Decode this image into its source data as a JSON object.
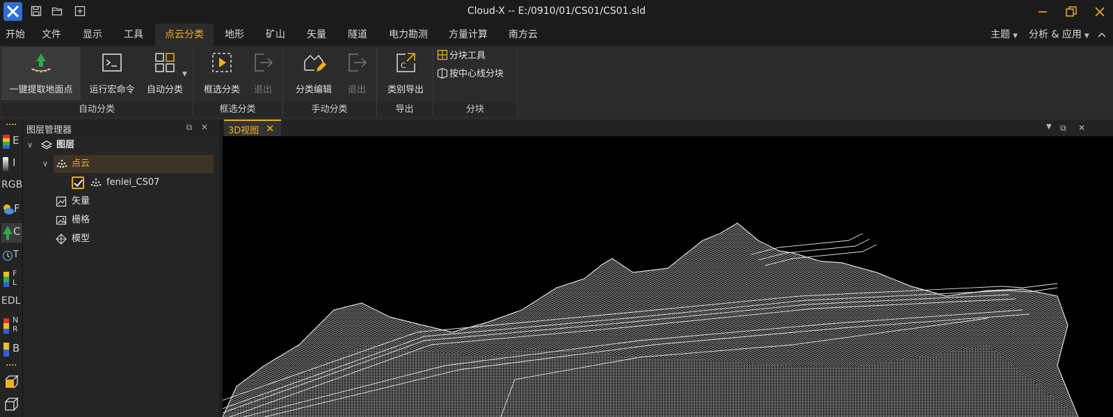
{
  "window": {
    "title": "Cloud-X -- E:/0910/01/CS01/CS01.sld"
  },
  "menu": {
    "tabs": [
      "开始",
      "文件",
      "显示",
      "工具",
      "点云分类",
      "地形",
      "矿山",
      "矢量",
      "隧道",
      "电力勘测",
      "方量计算",
      "南方云"
    ],
    "active_tab": "点云分类",
    "right": {
      "theme": "主题",
      "apps": "分析 & 应用"
    }
  },
  "ribbon": {
    "buttons": {
      "extract_ground": "一键提取地面点",
      "run_macro": "运行宏命令",
      "auto_classify": "自动分类",
      "box_classify": "框选分类",
      "exit_box": "退出",
      "edit_classify": "分类编辑",
      "exit_edit": "退出",
      "export_class": "类别导出",
      "block_tool": "分块工具",
      "block_by_centerline": "按中心线分块"
    },
    "groups": {
      "auto": "自动分类",
      "box": "框选分类",
      "manual": "手动分类",
      "export": "导出",
      "block": "分块"
    }
  },
  "toolstrip": {
    "items": [
      "E",
      "I",
      "RGB",
      "F",
      "C",
      "T",
      "F L",
      "EDL",
      "N R",
      "B"
    ]
  },
  "layer_panel": {
    "title": "图层管理器",
    "root": "图层",
    "pointcloud_group": "点云",
    "pointcloud_item": "fenlei_CS07",
    "vector": "矢量",
    "raster": "栅格",
    "model": "模型"
  },
  "view": {
    "tab_label": "3D视图"
  },
  "colors": {
    "accent": "#f0b020",
    "background": "#1e1e1e",
    "viewport": "#000000"
  }
}
